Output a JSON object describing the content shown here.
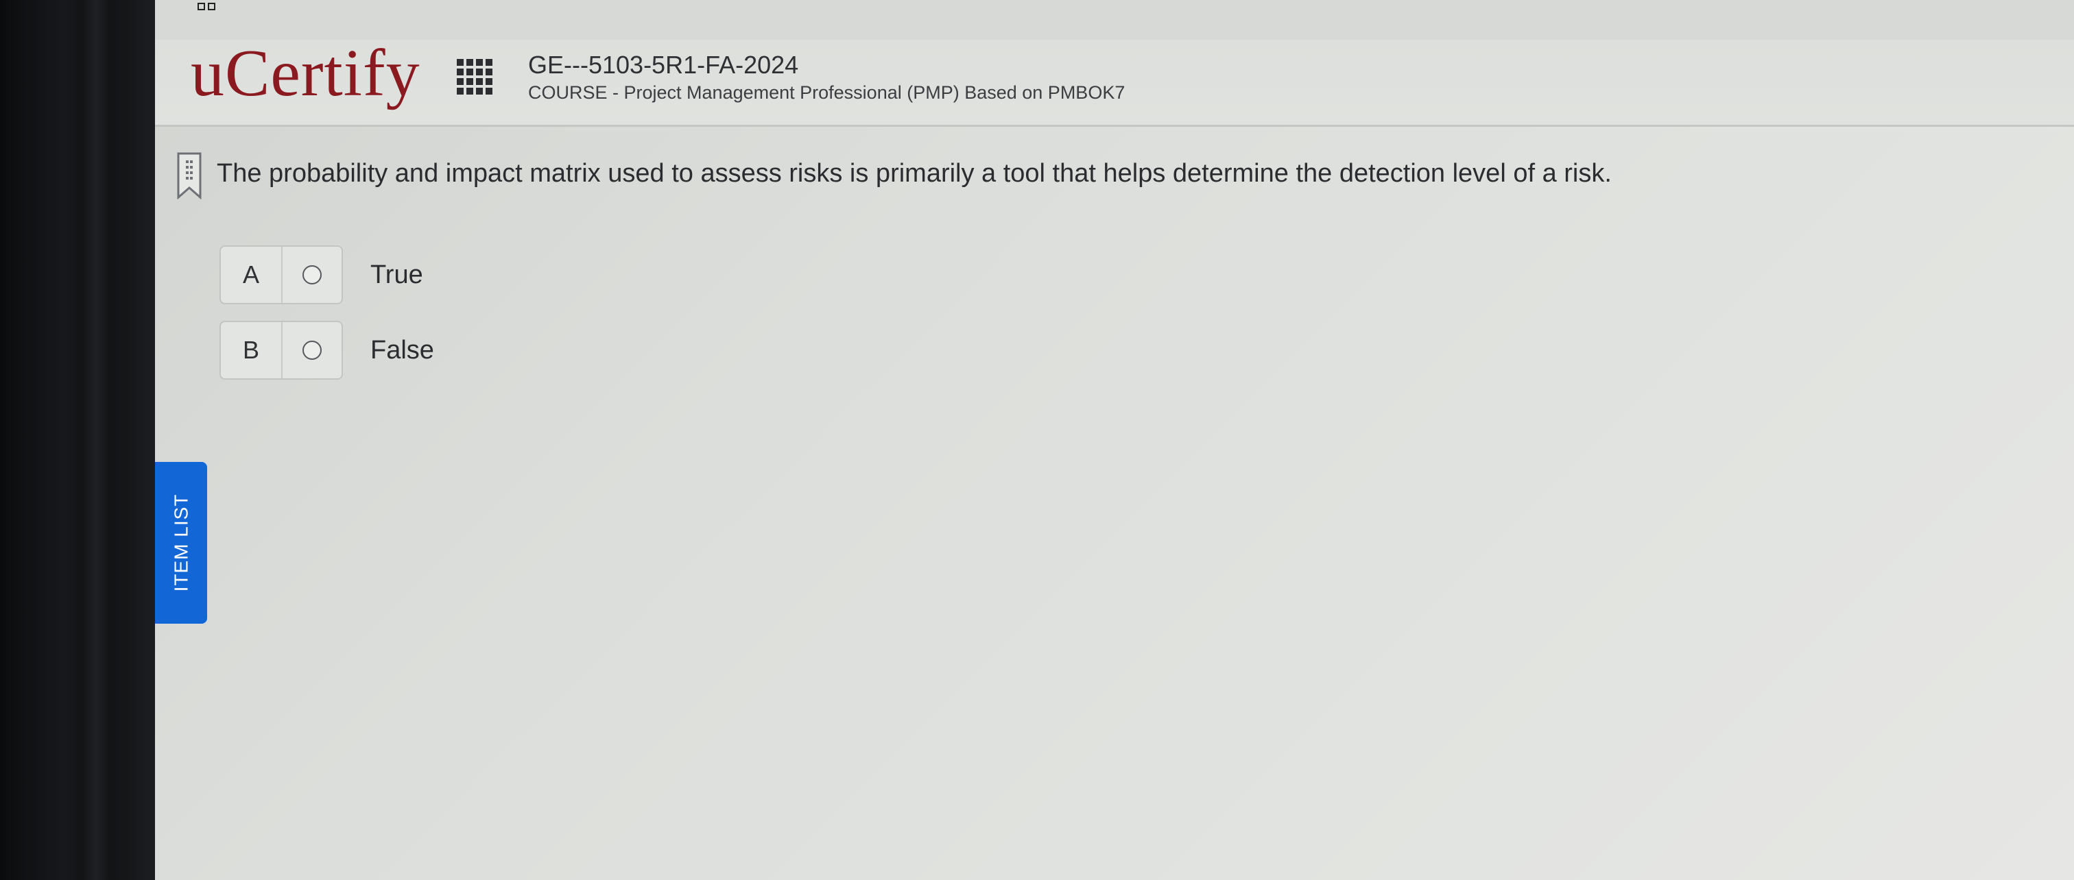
{
  "header": {
    "logo": "uCertify",
    "course_code": "GE---5103-5R1-FA-2024",
    "course_name": "COURSE - Project Management Professional (PMP) Based on PMBOK7",
    "icons": [
      "apps-grid-icon"
    ]
  },
  "question": {
    "text": "The probability and impact matrix used to assess risks is primarily a tool that helps determine the detection level of a risk.",
    "bookmark_icon": "bookmark-icon",
    "options": [
      {
        "letter": "A",
        "text": "True"
      },
      {
        "letter": "B",
        "text": "False"
      }
    ]
  },
  "sidebar": {
    "item_list_label": "ITEM LIST"
  },
  "colors": {
    "logo": "#8a1a1f",
    "item_list_tab": "#1366d6"
  }
}
